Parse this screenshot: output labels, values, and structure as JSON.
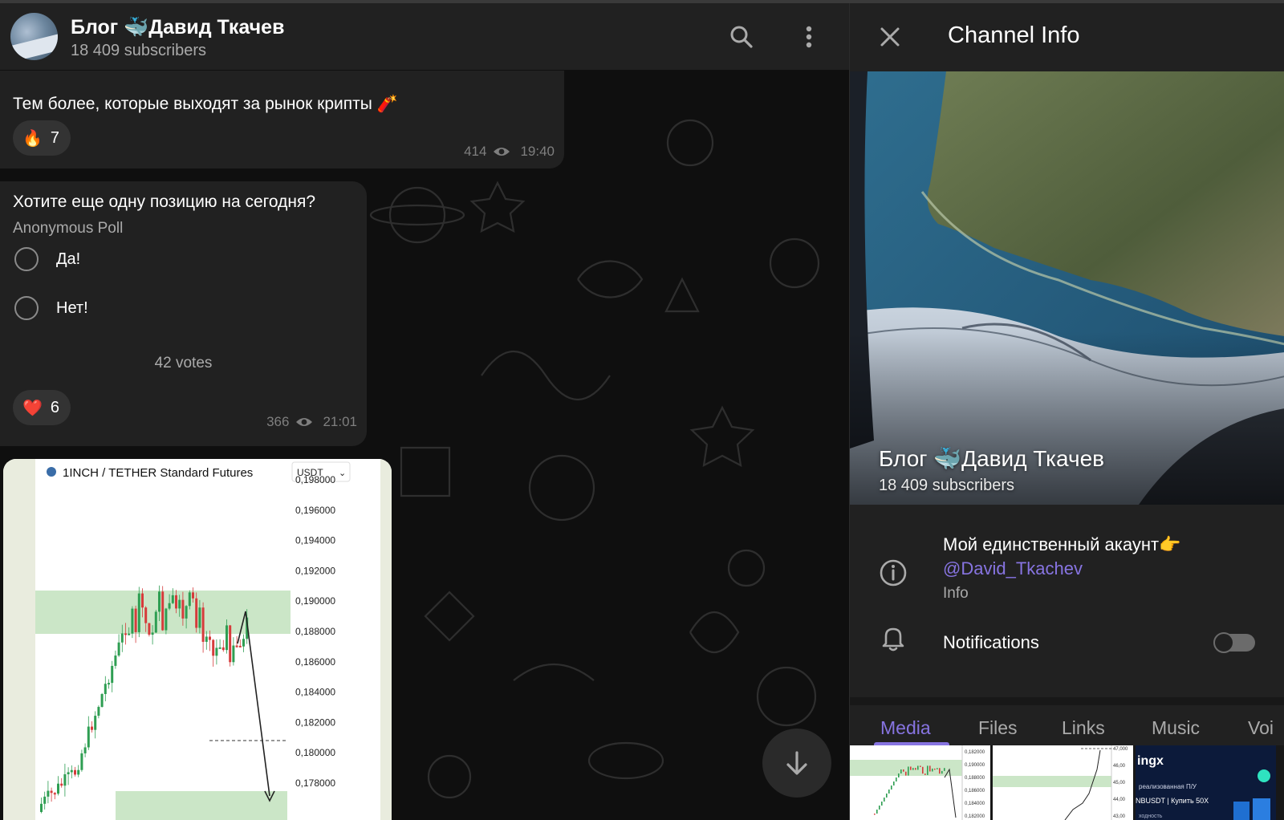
{
  "chat": {
    "title": "Блог 🐳Давид Ткачев",
    "subscribers": "18 409 subscribers",
    "messages": {
      "m1": {
        "text": "Тем более, которые выходят за рынок крипты 🧨",
        "reaction_emoji": "🔥",
        "reaction_count": "7",
        "views": "414",
        "time": "19:40"
      },
      "poll": {
        "question": "Хотите еще одну позицию на сегодня?",
        "type": "Anonymous Poll",
        "options": [
          "Да!",
          "Нет!"
        ],
        "votes": "42 votes",
        "reaction_emoji": "❤️",
        "reaction_count": "6",
        "views": "366",
        "time": "21:01"
      },
      "chart_image": {
        "title": "1INCH / TETHER Standard Futures",
        "currency": "USDT",
        "price_labels": [
          "0,198000",
          "0,196000",
          "0,194000",
          "0,192000",
          "0,190000",
          "0,188000",
          "0,186000",
          "0,184000",
          "0,182000",
          "0,180000",
          "0,178000"
        ]
      }
    }
  },
  "panel": {
    "title": "Channel Info",
    "channel_name": "Блог 🐳Давид Ткачев",
    "subscribers": "18 409 subscribers",
    "description": "Мой единственный акаунт👉",
    "link": "@David_Tkachev",
    "info_label": "Info",
    "notifications_label": "Notifications",
    "notifications_on": false,
    "tabs": [
      "Media",
      "Files",
      "Links",
      "Music",
      "Voi"
    ],
    "active_tab": "Media",
    "thumb3": {
      "brand": "ingx",
      "line1": "реализованная П/У",
      "line2": "NBUSDT | Купить  50X",
      "line3": "ходность"
    },
    "thumb1_labels": [
      "0,182000",
      "0,190000",
      "0,188000",
      "0,186000",
      "0,184000",
      "0,182000"
    ],
    "thumb2_labels": [
      "47,000",
      "46,00",
      "45,00",
      "44,00",
      "43,00"
    ]
  },
  "colors": {
    "accent": "#8774e1",
    "background": "#0f0f0f",
    "bubble": "#212121",
    "secondary_text": "#aaaaaa"
  }
}
